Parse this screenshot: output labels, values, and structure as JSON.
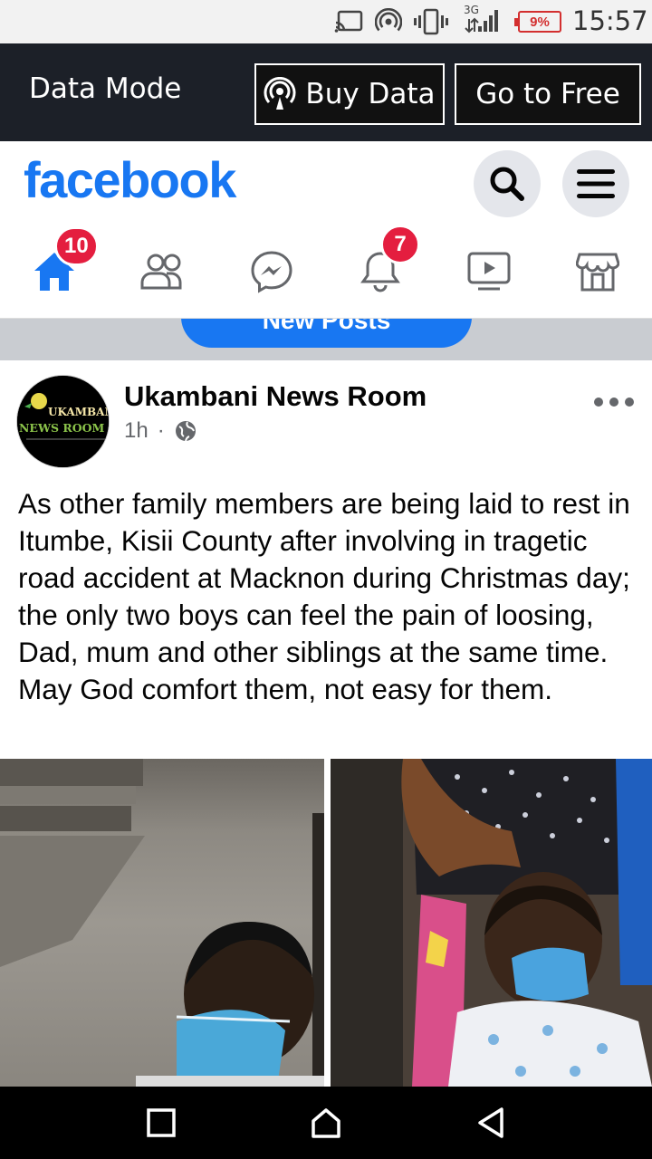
{
  "status_bar": {
    "battery": "9%",
    "time": "15:57",
    "network_label": "3G",
    "icons": [
      "cast-icon",
      "hotspot-icon",
      "vibrate-icon",
      "signal-icon",
      "battery-icon"
    ],
    "battery_color": "#d32f2f"
  },
  "data_bar": {
    "mode_label": "Data Mode",
    "buy_label": "Buy Data",
    "free_label": "Go to Free"
  },
  "header": {
    "logo": "facebook",
    "brand_color": "#1877f2",
    "icons": [
      "search-icon",
      "menu-icon"
    ]
  },
  "nav": {
    "items": [
      {
        "name": "home",
        "icon": "home-icon",
        "badge": "10",
        "active": true
      },
      {
        "name": "friends",
        "icon": "friends-icon",
        "badge": null
      },
      {
        "name": "messenger",
        "icon": "messenger-icon",
        "badge": null
      },
      {
        "name": "notifications",
        "icon": "bell-icon",
        "badge": "7"
      },
      {
        "name": "watch",
        "icon": "video-icon",
        "badge": null
      },
      {
        "name": "marketplace",
        "icon": "marketplace-icon",
        "badge": null
      }
    ]
  },
  "feed": {
    "new_posts_label": "New Posts",
    "post": {
      "author": "Ukambani News Room",
      "time": "1h",
      "separator": "·",
      "privacy_icon": "globe-icon",
      "avatar_text_top": "UKAMBANI",
      "avatar_text_bottom": "NEWS ROOM",
      "text": "As other family members are being laid to rest in Itumbe, Kisii County after involving in tragetic road accident at Macknon during Christmas day; the only two boys can feel the pain of loosing, Dad, mum and other siblings at the same time. May God comfort them, not easy for them."
    }
  },
  "android_nav": {
    "icons": [
      "recents-icon",
      "home-icon",
      "back-icon"
    ]
  }
}
